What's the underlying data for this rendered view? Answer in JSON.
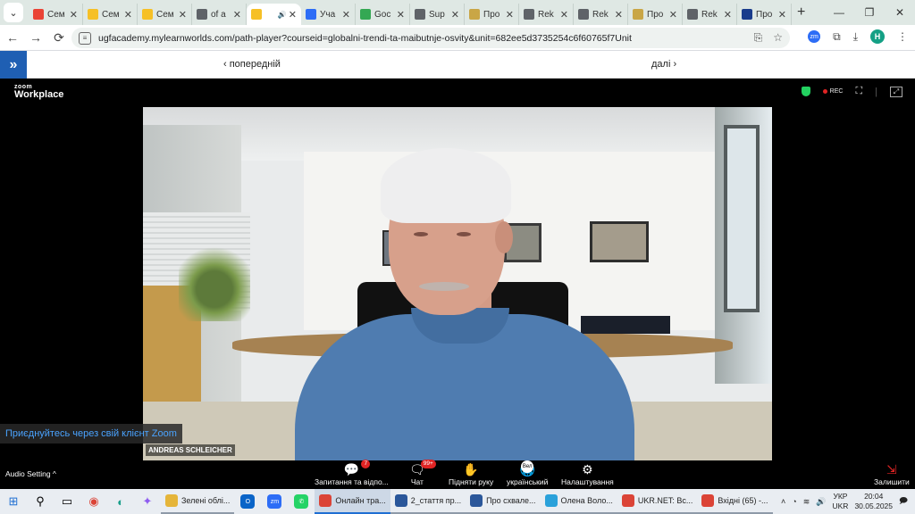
{
  "browser": {
    "tabs": [
      {
        "icon": "gmail-icon",
        "label": "Сем",
        "color": "#ea4335"
      },
      {
        "icon": "sticky-note-icon",
        "label": "Сем",
        "color": "#f6c026"
      },
      {
        "icon": "sticky-note-icon",
        "label": "Сем",
        "color": "#f6c026"
      },
      {
        "icon": "globe-icon",
        "label": "of a",
        "color": "#5f6368"
      },
      {
        "icon": "sticky-note-icon",
        "label": "",
        "color": "#f6c026",
        "active": true
      },
      {
        "icon": "zoom-icon",
        "label": "Уча",
        "color": "#2d6df6"
      },
      {
        "icon": "google-icon",
        "label": "Goc",
        "color": "#34a853"
      },
      {
        "icon": "globe-icon",
        "label": "Sup",
        "color": "#5f6368"
      },
      {
        "icon": "shield-icon",
        "label": "Про",
        "color": "#c9a646"
      },
      {
        "icon": "globe-icon",
        "label": "Rek",
        "color": "#5f6368"
      },
      {
        "icon": "globe-icon",
        "label": "Rek",
        "color": "#5f6368"
      },
      {
        "icon": "shield-icon",
        "label": "Про",
        "color": "#c9a646"
      },
      {
        "icon": "globe-icon",
        "label": "Rek",
        "color": "#5f6368"
      },
      {
        "icon": "bookmark-icon",
        "label": "Про",
        "color": "#1a3c8c"
      }
    ],
    "url": "ugfacademy.mylearnworlds.com/path-player?courseid=globalni-trendi-ta-maibutnje-osvity&unit=682ee5d3735254c6f60765f7Unit",
    "profile_initial": "H"
  },
  "course_nav": {
    "prev_label": "‹ попередній",
    "next_label": "далі ›"
  },
  "zoom": {
    "logo_top": "zoom",
    "logo_bottom": "Workplace",
    "rec_label": "REC",
    "speaker_name": "ANDREAS SCHLEICHER",
    "join_client": "Приєднуйтесь через свій клієнт Zoom",
    "audio_setting": "Audio Setting ^",
    "controls": [
      {
        "icon": "qa-icon",
        "label": "Запитання та відпо...",
        "badge": "7"
      },
      {
        "icon": "chat-icon",
        "label": "Чат",
        "badge": "99+"
      },
      {
        "icon": "raise-hand-icon",
        "label": "Підняти руку",
        "badge": ""
      },
      {
        "icon": "language-icon",
        "label": "український",
        "badge": ""
      },
      {
        "icon": "settings-icon",
        "label": "Налаштування",
        "badge": ""
      }
    ],
    "chip_text": "Вел",
    "leave_label": "Залишити"
  },
  "taskbar": {
    "apps": [
      {
        "icon": "folder-icon",
        "label": "Зелені облі...",
        "color": "#e5b53a"
      },
      {
        "icon": "chrome-icon",
        "label": "Онлайн тра...",
        "color": "#db4437",
        "active": true
      },
      {
        "icon": "word-icon",
        "label": "2_стаття пр...",
        "color": "#2b579a"
      },
      {
        "icon": "word-icon",
        "label": "Про схвале...",
        "color": "#2b579a"
      },
      {
        "icon": "telegram-icon",
        "label": "Олена Воло...",
        "color": "#2aa1da"
      },
      {
        "icon": "chrome-icon",
        "label": "UKR.NET: Вс...",
        "color": "#db4437"
      },
      {
        "icon": "chrome-icon",
        "label": "Вхідні (65) -...",
        "color": "#db4437"
      }
    ],
    "lang_top": "УКР",
    "lang_bottom": "UKR",
    "time": "20:04",
    "date": "30.05.2025"
  }
}
